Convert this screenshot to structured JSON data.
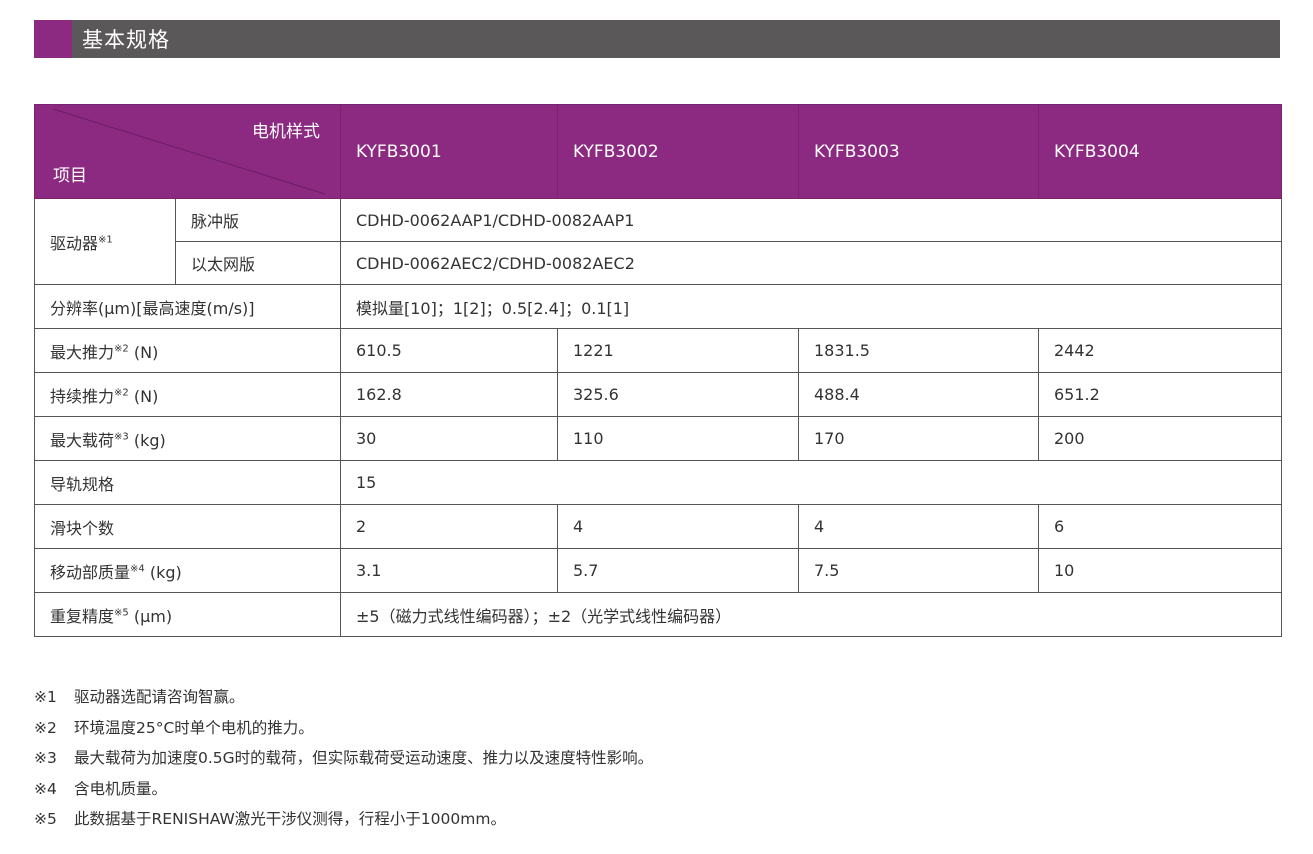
{
  "section": {
    "title": "基本规格"
  },
  "colors": {
    "accent": "#8c2a82",
    "section_bar": "#5a5858"
  },
  "table": {
    "corner_top": "电机样式",
    "corner_bottom": "项目",
    "models": [
      "KYFB3001",
      "KYFB3002",
      "KYFB3003",
      "KYFB3004"
    ],
    "driver": {
      "label": "驱动器",
      "note": "※1",
      "variants": [
        {
          "label": "脉冲版",
          "value": "CDHD-0062AAP1/CDHD-0082AAP1"
        },
        {
          "label": "以太网版",
          "value": "CDHD-0062AEC2/CDHD-0082AEC2"
        }
      ]
    },
    "resolution": {
      "label": "分辨率(μm)[最高速度(m/s)]",
      "value": "模拟量[10]；1[2]；0.5[2.4]；0.1[1]"
    },
    "rows": [
      {
        "label": "最大推力",
        "note": "※2",
        "unit": " (N)",
        "values": [
          "610.5",
          "1221",
          "1831.5",
          "2442"
        ]
      },
      {
        "label": "持续推力",
        "note": "※2",
        "unit": " (N)",
        "values": [
          "162.8",
          "325.6",
          "488.4",
          "651.2"
        ]
      },
      {
        "label": "最大载荷",
        "note": "※3",
        "unit": " (kg)",
        "values": [
          "30",
          "110",
          "170",
          "200"
        ]
      }
    ],
    "rail": {
      "label": "导轨规格",
      "value": "15"
    },
    "sliders": {
      "label": "滑块个数",
      "values": [
        "2",
        "4",
        "4",
        "6"
      ]
    },
    "moving_mass": {
      "label": "移动部质量",
      "note": "※4",
      "unit": " (kg)",
      "values": [
        "3.1",
        "5.7",
        "7.5",
        "10"
      ]
    },
    "repeatability": {
      "label": "重复精度",
      "note": "※5",
      "unit": " (μm)",
      "value": "±5（磁力式线性编码器）；±2（光学式线性编码器）"
    }
  },
  "notes": [
    {
      "mark": "※1",
      "text": "驱动器选配请咨询智赢。"
    },
    {
      "mark": "※2",
      "text": "环境温度25°C时单个电机的推力。"
    },
    {
      "mark": "※3",
      "text": "最大载荷为加速度0.5G时的载荷，但实际载荷受运动速度、推力以及速度特性影响。"
    },
    {
      "mark": "※4",
      "text": "含电机质量。"
    },
    {
      "mark": "※5",
      "text": "此数据基于RENISHAW激光干涉仪测得，行程小于1000mm。"
    }
  ]
}
